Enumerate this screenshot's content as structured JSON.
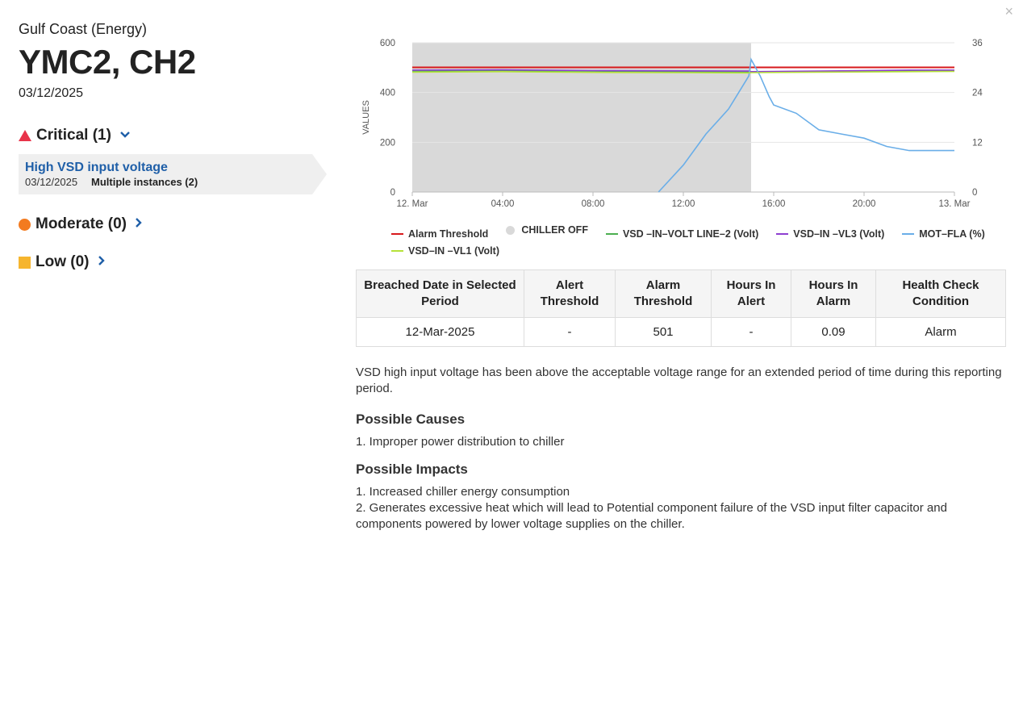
{
  "close_label": "×",
  "site": "Gulf Coast (Energy)",
  "asset": "YMC2, CH2",
  "date": "03/12/2025",
  "severity": {
    "critical_label": "Critical (1)",
    "moderate_label": "Moderate (0)",
    "low_label": "Low (0)",
    "chevron_down": "⌄",
    "chevron_right": "›"
  },
  "alert": {
    "title": "High VSD input voltage",
    "date": "03/12/2025",
    "instances": "Multiple instances (2)"
  },
  "chart_data": {
    "type": "line",
    "y_left": {
      "label": "VALUES",
      "ticks": [
        0,
        200,
        400,
        600
      ],
      "range": [
        0,
        600
      ]
    },
    "y_right": {
      "label": "%",
      "ticks": [
        0,
        12,
        24,
        36
      ],
      "range": [
        0,
        36
      ]
    },
    "x_ticks": [
      "12. Mar",
      "04:00",
      "08:00",
      "12:00",
      "16:00",
      "20:00",
      "13. Mar"
    ],
    "x_range_hours": [
      0,
      24
    ],
    "chiller_off_band_hours": [
      0,
      15
    ],
    "series": [
      {
        "name": "Alarm Threshold",
        "color": "#d7191c",
        "axis": "left",
        "x": [
          0,
          24
        ],
        "y": [
          501,
          501
        ]
      },
      {
        "name": "CHILLER OFF",
        "color": "#d9d9d9",
        "type": "band"
      },
      {
        "name": "VSD –IN–VOLT LINE–2 (Volt)",
        "color": "#4caf50",
        "axis": "left",
        "x": [
          0,
          4,
          8,
          12,
          14.9,
          15,
          18,
          22,
          24
        ],
        "y": [
          487,
          488,
          486,
          484,
          483,
          482,
          485,
          487,
          488
        ]
      },
      {
        "name": "VSD–IN –VL3 (Volt)",
        "color": "#8e3fd0",
        "axis": "left",
        "x": [
          0,
          4,
          8,
          12,
          14.9,
          15,
          18,
          22,
          24
        ],
        "y": [
          490,
          491,
          488,
          487,
          486,
          484,
          486,
          490,
          490
        ]
      },
      {
        "name": "MOT–FLA (%)",
        "color": "#6aaee8",
        "axis": "right",
        "x": [
          10.9,
          12,
          13,
          14,
          14.9,
          15,
          15.4,
          15.8,
          16,
          17,
          18,
          19,
          20,
          21,
          22,
          23,
          24
        ],
        "y": [
          0,
          6.5,
          14,
          20,
          28,
          32,
          28,
          23,
          21,
          19,
          15,
          14,
          13,
          11,
          10,
          10,
          10
        ]
      },
      {
        "name": "VSD–IN –VL1 (Volt)",
        "color": "#b6e23a",
        "axis": "left",
        "x": [
          0,
          4,
          8,
          12,
          14.9,
          15,
          18,
          22,
          24
        ],
        "y": [
          482,
          484,
          481,
          480,
          479,
          480,
          482,
          484,
          485
        ]
      }
    ]
  },
  "table": {
    "headers": [
      "Breached Date in Selected Period",
      "Alert Threshold",
      "Alarm Threshold",
      "Hours In Alert",
      "Hours In Alarm",
      "Health Check Condition"
    ],
    "rows": [
      [
        "12-Mar-2025",
        "-",
        "501",
        "-",
        "0.09",
        "Alarm"
      ]
    ]
  },
  "description": "VSD high input voltage has been above the acceptable voltage range for an extended period of time during this reporting period.",
  "causes_title": "Possible Causes",
  "causes": [
    "1. Improper power distribution to chiller"
  ],
  "impacts_title": "Possible Impacts",
  "impacts": [
    "1. Increased chiller energy consumption",
    "2. Generates excessive heat which will lead to Potential component failure of the VSD input filter capacitor and components powered by lower voltage supplies on the chiller."
  ]
}
